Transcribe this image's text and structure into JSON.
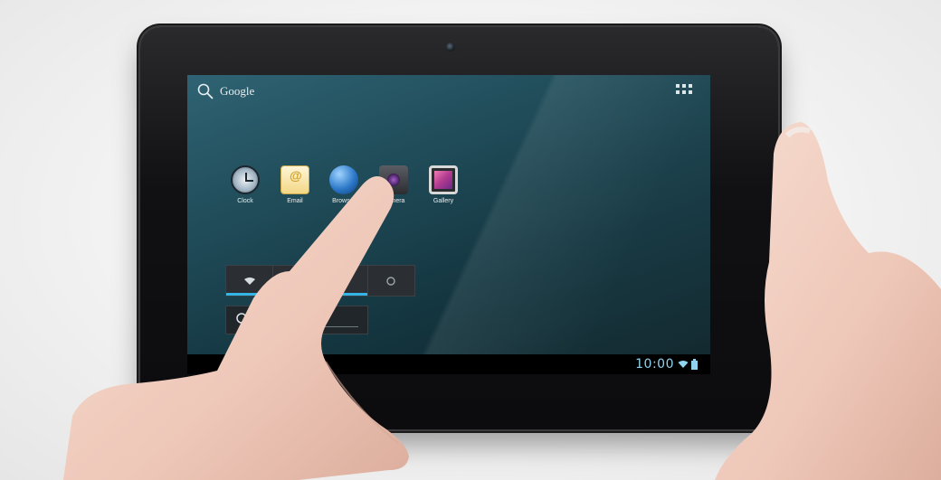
{
  "search": {
    "label": "Google"
  },
  "apps": [
    {
      "name": "Clock",
      "icon": "clock-icon"
    },
    {
      "name": "Email",
      "icon": "email-icon"
    },
    {
      "name": "Browser",
      "icon": "browser-icon"
    },
    {
      "name": "Camera",
      "icon": "camera-icon"
    },
    {
      "name": "Gallery",
      "icon": "gallery-icon"
    }
  ],
  "status": {
    "time": "10:00",
    "wifi_icon": "wifi-icon",
    "battery_icon": "battery-icon"
  },
  "colors": {
    "accent": "#33b5e5",
    "screen_top": "#2f6373",
    "screen_bottom": "#0e2329"
  }
}
